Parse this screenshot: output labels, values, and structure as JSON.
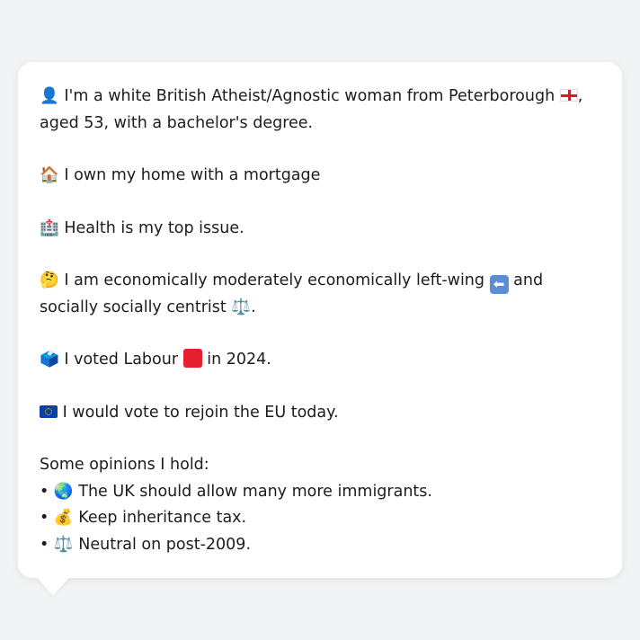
{
  "profile": {
    "intro_emoji": "👤",
    "intro_text_1": "I'm a white British Atheist/Agnostic woman from Peterborough",
    "intro_text_2": ", aged 53, with a bachelor's degree.",
    "home_emoji": "🏠",
    "home_text": "I own my home with a mortgage",
    "health_emoji": "🏥",
    "health_text": "Health is my top issue.",
    "econ_emoji": "🤔",
    "econ_text_1": "I am economically moderately economically left-wing",
    "econ_text_2": "and socially socially centrist",
    "econ_scale_emoji": "⚖️",
    "econ_text_3": ".",
    "vote_emoji": "🗳️",
    "vote_text_1": "I voted Labour",
    "vote_text_2": "in 2024.",
    "eu_text": "I would vote to rejoin the EU today."
  },
  "opinions": {
    "heading": "Some opinions I hold:",
    "items": [
      {
        "bullet": "•",
        "emoji": "🌏",
        "text": "The UK should allow many more immigrants."
      },
      {
        "bullet": "•",
        "emoji": "💰",
        "text": "Keep inheritance tax."
      },
      {
        "bullet": "•",
        "emoji": "⚖️",
        "text": "Neutral on post-2009."
      }
    ]
  },
  "colors": {
    "background": "#f2f3f5",
    "bubble": "#ffffff",
    "labour_red": "#e51f2d",
    "eu_blue": "#0a3fa3"
  },
  "icons": {
    "england_flag": "england-flag-icon",
    "eu_flag": "eu-flag-icon",
    "left_arrow": "left-arrow-icon",
    "red_square": "red-square-icon"
  }
}
